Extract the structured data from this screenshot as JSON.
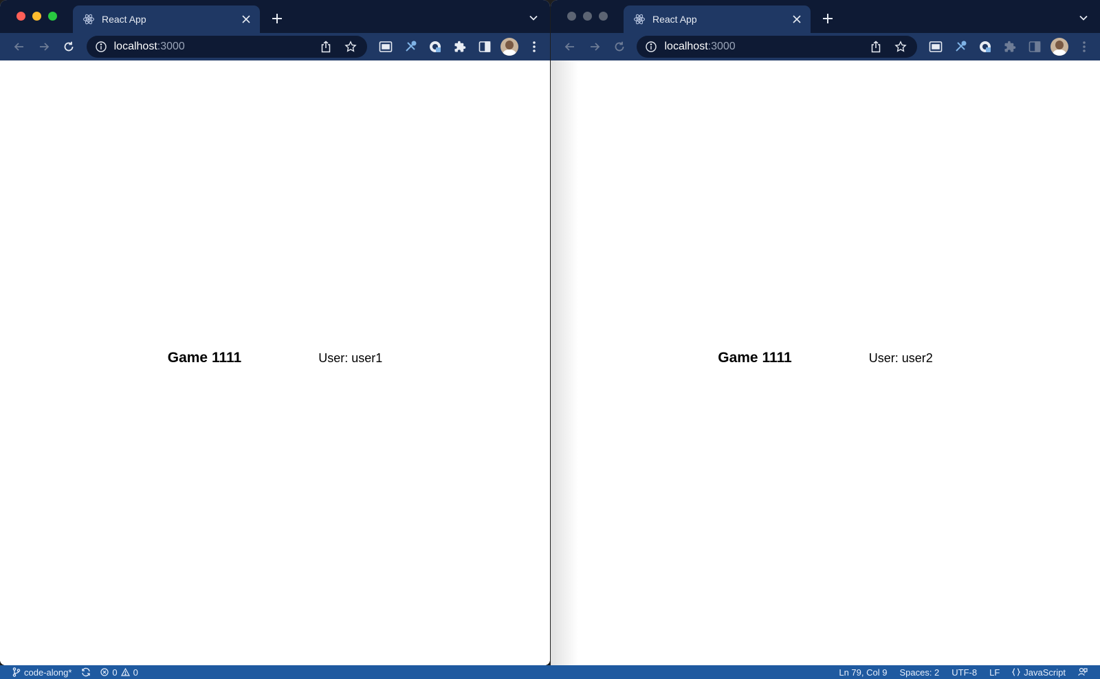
{
  "colors": {
    "chrome_dark": "#0e1a34",
    "chrome_tab": "#1f3864",
    "statusbar": "#1f5aa0",
    "page_bg": "#ffffff"
  },
  "left": {
    "tab_title": "React App",
    "url_host": "localhost",
    "url_port": ":3000",
    "game_title": "Game 1111",
    "user_label": "User: user1",
    "icons": [
      "react-favicon-icon",
      "close-icon",
      "plus-icon",
      "chevron-down-icon",
      "back-icon",
      "forward-icon",
      "reload-icon",
      "info-icon",
      "share-icon",
      "star-icon",
      "picture-in-picture-icon",
      "tools-icon",
      "password-manager-icon",
      "puzzle-icon",
      "side-panel-icon",
      "kebab-menu-icon"
    ]
  },
  "right": {
    "tab_title": "React App",
    "url_host": "localhost",
    "url_port": ":3000",
    "game_title": "Game 1111",
    "user_label": "User: user2"
  },
  "statusbar": {
    "branch": "code-along*",
    "errors": "0",
    "warnings": "0",
    "cursor": "Ln 79, Col 9",
    "spaces": "Spaces: 2",
    "encoding": "UTF-8",
    "eol": "LF",
    "language": "JavaScript"
  }
}
